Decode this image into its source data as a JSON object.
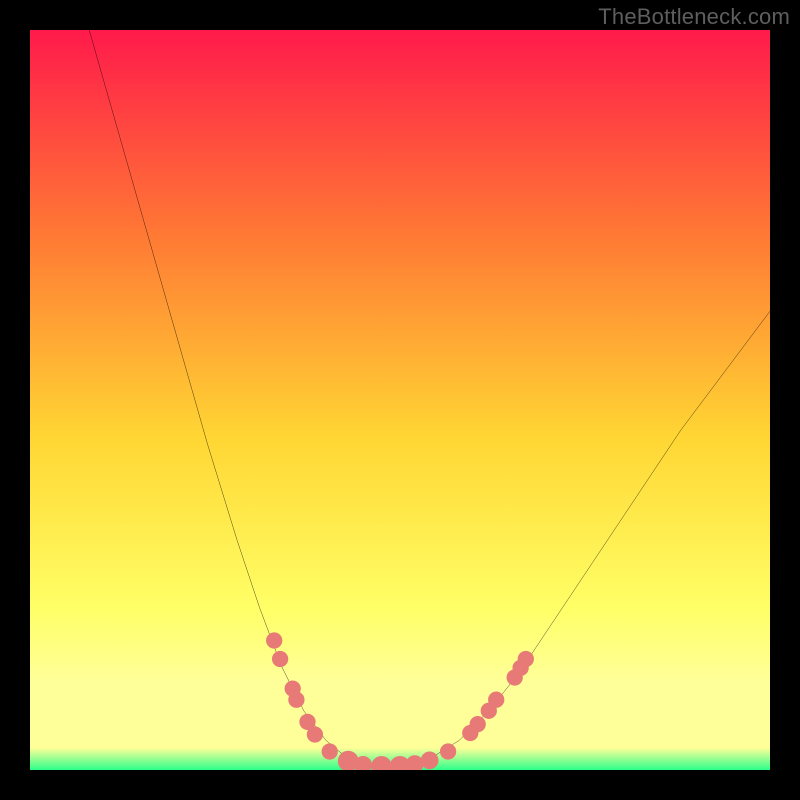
{
  "watermark": "TheBottleneck.com",
  "colors": {
    "frame_bg": "#000000",
    "grad_top": "#ff1a4b",
    "grad_mid_upper": "#ff7a34",
    "grad_mid": "#ffd633",
    "grad_lower": "#ffff66",
    "grad_band": "#ffff99",
    "grad_bottom": "#2cff8a",
    "curve": "#000000",
    "marker": "#e77a77"
  },
  "chart_data": {
    "type": "line",
    "title": "",
    "xlabel": "",
    "ylabel": "",
    "xlim": [
      0,
      100
    ],
    "ylim": [
      0,
      100
    ],
    "grid": false,
    "curve": {
      "name": "bottleneck-valley",
      "points": [
        {
          "x": 8,
          "y": 100
        },
        {
          "x": 12,
          "y": 86
        },
        {
          "x": 16,
          "y": 72
        },
        {
          "x": 20,
          "y": 58
        },
        {
          "x": 24,
          "y": 44
        },
        {
          "x": 28,
          "y": 31
        },
        {
          "x": 31,
          "y": 22
        },
        {
          "x": 34,
          "y": 14
        },
        {
          "x": 37,
          "y": 8
        },
        {
          "x": 40,
          "y": 4
        },
        {
          "x": 43,
          "y": 1.5
        },
        {
          "x": 46,
          "y": 0.5
        },
        {
          "x": 50,
          "y": 0.5
        },
        {
          "x": 54,
          "y": 1.5
        },
        {
          "x": 58,
          "y": 4
        },
        {
          "x": 62,
          "y": 8
        },
        {
          "x": 66,
          "y": 13
        },
        {
          "x": 70,
          "y": 19
        },
        {
          "x": 76,
          "y": 28
        },
        {
          "x": 82,
          "y": 37
        },
        {
          "x": 88,
          "y": 46
        },
        {
          "x": 94,
          "y": 54
        },
        {
          "x": 100,
          "y": 62
        }
      ]
    },
    "markers": [
      {
        "x": 33.0,
        "y": 17.5,
        "r": 1.1
      },
      {
        "x": 33.8,
        "y": 15.0,
        "r": 1.1
      },
      {
        "x": 35.5,
        "y": 11.0,
        "r": 1.1
      },
      {
        "x": 36.0,
        "y": 9.5,
        "r": 1.1
      },
      {
        "x": 37.5,
        "y": 6.5,
        "r": 1.1
      },
      {
        "x": 38.5,
        "y": 4.8,
        "r": 1.1
      },
      {
        "x": 40.5,
        "y": 2.5,
        "r": 1.1
      },
      {
        "x": 43.0,
        "y": 1.2,
        "r": 1.4
      },
      {
        "x": 45.0,
        "y": 0.7,
        "r": 1.2
      },
      {
        "x": 47.5,
        "y": 0.5,
        "r": 1.4
      },
      {
        "x": 50.0,
        "y": 0.5,
        "r": 1.4
      },
      {
        "x": 52.0,
        "y": 0.8,
        "r": 1.2
      },
      {
        "x": 54.0,
        "y": 1.3,
        "r": 1.2
      },
      {
        "x": 56.5,
        "y": 2.5,
        "r": 1.1
      },
      {
        "x": 59.5,
        "y": 5.0,
        "r": 1.1
      },
      {
        "x": 60.5,
        "y": 6.2,
        "r": 1.1
      },
      {
        "x": 62.0,
        "y": 8.0,
        "r": 1.1
      },
      {
        "x": 63.0,
        "y": 9.5,
        "r": 1.1
      },
      {
        "x": 65.5,
        "y": 12.5,
        "r": 1.1
      },
      {
        "x": 66.3,
        "y": 13.8,
        "r": 1.1
      },
      {
        "x": 67.0,
        "y": 15.0,
        "r": 1.1
      }
    ]
  }
}
